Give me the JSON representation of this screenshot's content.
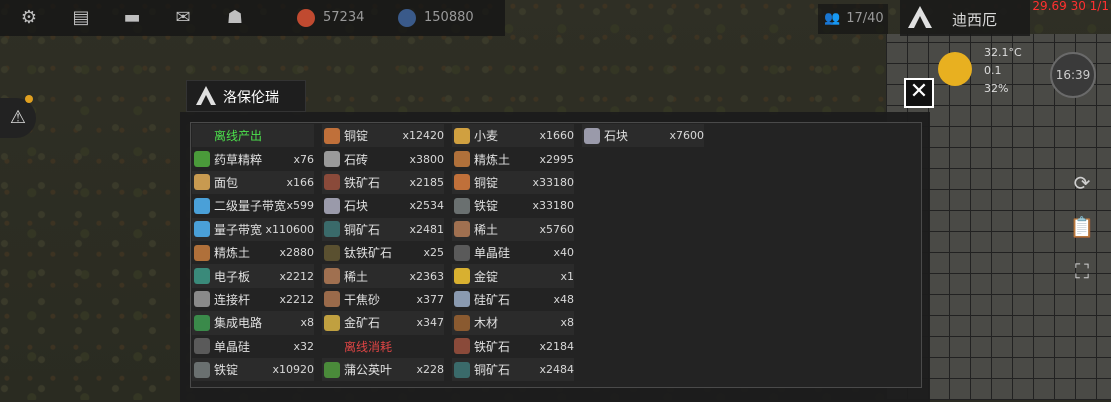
{
  "topbar": {
    "icons": [
      "gear-icon",
      "notes-icon",
      "chat-icon",
      "mail-icon",
      "profile-icon"
    ],
    "resource_a": "57234",
    "resource_b": "150880",
    "population": "17/40",
    "user_name": "迪西厄",
    "time": "29.69 30 1/1"
  },
  "weather": {
    "temperature": "32.1°C",
    "wind": "0.1",
    "humidity": "32%",
    "clock": "16:39"
  },
  "dialog": {
    "title": "洛保伦瑞",
    "close_label": "✕",
    "offline_output_header": "离线产出",
    "offline_consume_header": "离线消耗"
  },
  "columns": [
    [
      {
        "type": "header",
        "label": "离线产出",
        "color": "green"
      },
      {
        "label": "药草精粹",
        "qty": "x76",
        "icon": "herb-extract-icon",
        "color": "#4a9a3a"
      },
      {
        "label": "面包",
        "qty": "x166",
        "icon": "bread-icon",
        "color": "#c89a50"
      },
      {
        "label": "二级量子带宽",
        "qty": "x599",
        "icon": "quantum-bandwidth-2-icon",
        "color": "#4aa0d8"
      },
      {
        "label": "量子带宽",
        "qty": "x110600",
        "icon": "quantum-bandwidth-icon",
        "color": "#4aa0d8"
      },
      {
        "label": "精炼土",
        "qty": "x2880",
        "icon": "refined-soil-icon",
        "color": "#b0703a"
      },
      {
        "label": "电子板",
        "qty": "x2212",
        "icon": "circuit-board-icon",
        "color": "#3a8a7a"
      },
      {
        "label": "连接杆",
        "qty": "x2212",
        "icon": "connector-rod-icon",
        "color": "#8a8a8a"
      },
      {
        "label": "集成电路",
        "qty": "x8",
        "icon": "integrated-circuit-icon",
        "color": "#3a8a4a"
      },
      {
        "label": "单晶硅",
        "qty": "x32",
        "icon": "monocrystal-silicon-icon",
        "color": "#5a5a5a"
      },
      {
        "label": "铁锭",
        "qty": "x10920",
        "icon": "iron-ingot-icon",
        "color": "#6a7070"
      }
    ],
    [
      {
        "label": "铜锭",
        "qty": "x12420",
        "icon": "copper-ingot-icon",
        "color": "#c0703a"
      },
      {
        "label": "石砖",
        "qty": "x3800",
        "icon": "stone-brick-icon",
        "color": "#9a9a9a"
      },
      {
        "label": "铁矿石",
        "qty": "x2185",
        "icon": "iron-ore-icon",
        "color": "#8a4a3a"
      },
      {
        "label": "石块",
        "qty": "x2534",
        "icon": "stone-icon",
        "color": "#9a9aaa"
      },
      {
        "label": "铜矿石",
        "qty": "x2481",
        "icon": "copper-ore-icon",
        "color": "#3a6a6a"
      },
      {
        "label": "钛铁矿石",
        "qty": "x25",
        "icon": "ilmenite-ore-icon",
        "color": "#5a5030"
      },
      {
        "label": "稀土",
        "qty": "x2363",
        "icon": "rare-earth-icon",
        "color": "#a07050"
      },
      {
        "label": "干焦砂",
        "qty": "x377",
        "icon": "coke-sand-icon",
        "color": "#9a6a4a"
      },
      {
        "label": "金矿石",
        "qty": "x347",
        "icon": "gold-ore-icon",
        "color": "#c0a040"
      },
      {
        "type": "header",
        "label": "离线消耗",
        "color": "red"
      },
      {
        "label": "蒲公英叶",
        "qty": "x228",
        "icon": "dandelion-leaf-icon",
        "color": "#4a8a3a"
      }
    ],
    [
      {
        "label": "小麦",
        "qty": "x1660",
        "icon": "wheat-icon",
        "color": "#d0a040"
      },
      {
        "label": "精炼土",
        "qty": "x2995",
        "icon": "refined-soil-icon",
        "color": "#b0703a"
      },
      {
        "label": "铜锭",
        "qty": "x33180",
        "icon": "copper-ingot-icon",
        "color": "#c0703a"
      },
      {
        "label": "铁锭",
        "qty": "x33180",
        "icon": "iron-ingot-icon",
        "color": "#6a7070"
      },
      {
        "label": "稀土",
        "qty": "x5760",
        "icon": "rare-earth-icon",
        "color": "#a07050"
      },
      {
        "label": "单晶硅",
        "qty": "x40",
        "icon": "monocrystal-silicon-icon",
        "color": "#5a5a5a"
      },
      {
        "label": "金锭",
        "qty": "x1",
        "icon": "gold-ingot-icon",
        "color": "#d8b030"
      },
      {
        "label": "硅矿石",
        "qty": "x48",
        "icon": "silicon-ore-icon",
        "color": "#8a9ab0"
      },
      {
        "label": "木材",
        "qty": "x8",
        "icon": "wood-icon",
        "color": "#8a5a30"
      },
      {
        "label": "铁矿石",
        "qty": "x2184",
        "icon": "iron-ore-icon",
        "color": "#8a4a3a"
      },
      {
        "label": "铜矿石",
        "qty": "x2484",
        "icon": "copper-ore-icon",
        "color": "#3a6a6a"
      }
    ],
    [
      {
        "label": "石块",
        "qty": "x7600",
        "icon": "stone-icon",
        "color": "#9a9aaa"
      }
    ]
  ]
}
